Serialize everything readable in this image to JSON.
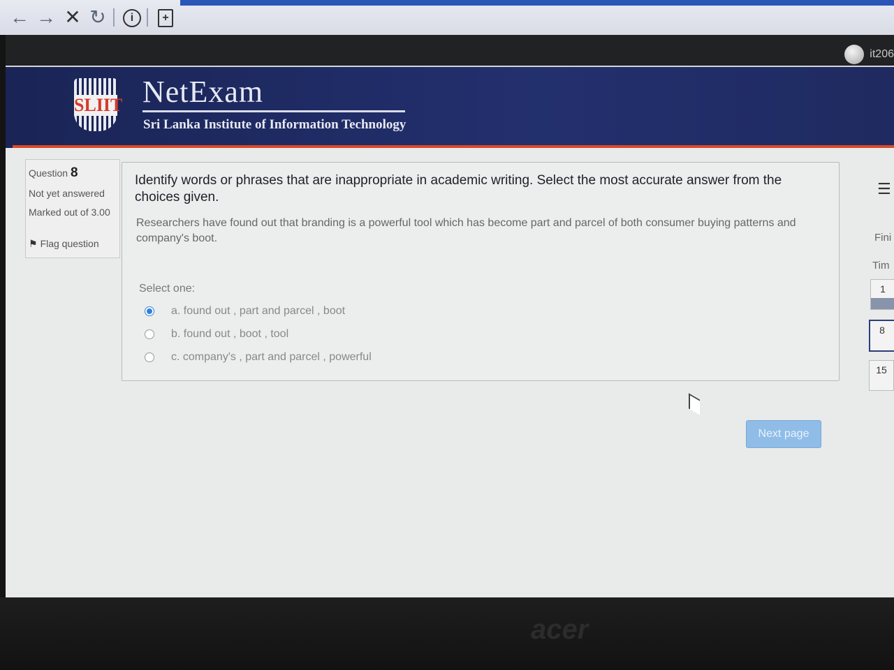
{
  "browser": {
    "back_glyph": "←",
    "forward_glyph": "→",
    "stop_glyph": "✕",
    "reload_glyph": "↻",
    "info_glyph": "i",
    "page_glyph": "+"
  },
  "site": {
    "username": "it206",
    "brand_title": "NetExam",
    "brand_subtitle": "Sri Lanka Institute of Information Technology",
    "logo_text": "SLIIT"
  },
  "question_info": {
    "label": "Question",
    "number": "8",
    "state": "Not yet answered",
    "grade": "Marked out of 3.00",
    "flag_label": "Flag question"
  },
  "question": {
    "text": "Identify words or phrases that are inappropriate in academic writing. Select the most accurate answer from the choices given.",
    "passage": "Researchers have found out that branding is a powerful tool which has become part and parcel of both consumer buying patterns and company's boot.",
    "select_label": "Select one:",
    "options": [
      {
        "label": "a. found out , part and parcel , boot",
        "selected": true
      },
      {
        "label": "b. found out , boot , tool",
        "selected": false
      },
      {
        "label": "c. company's , part and parcel , powerful",
        "selected": false
      }
    ]
  },
  "actions": {
    "next_label": "Next page"
  },
  "nav": {
    "finish_label": "Fini",
    "timer_label": "Tim",
    "questions": [
      "1",
      "8",
      "15"
    ]
  },
  "laptop_brand": "acer"
}
